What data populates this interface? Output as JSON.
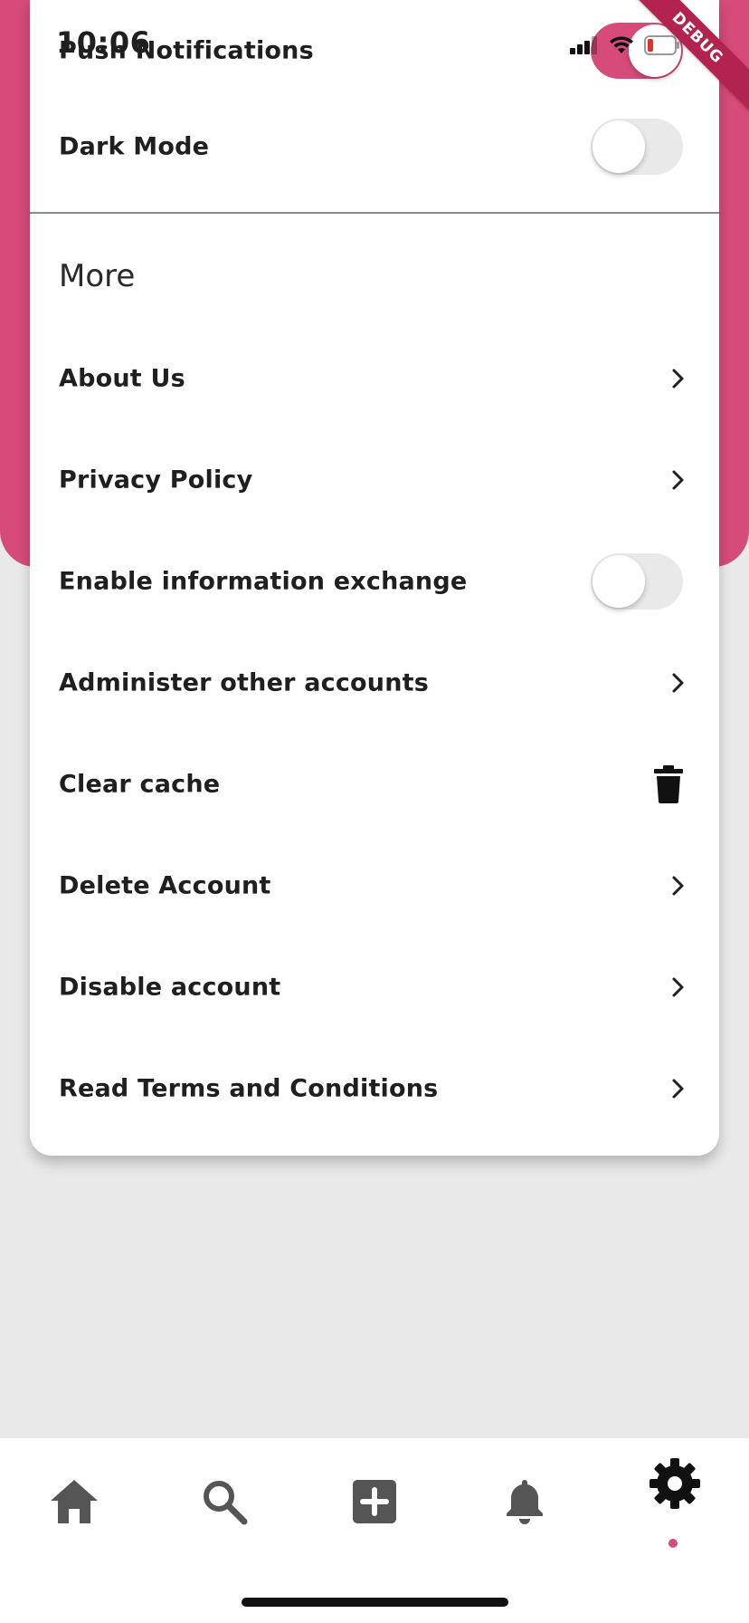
{
  "status_bar": {
    "time": "10:06"
  },
  "debug_banner": "DEBUG",
  "settings": {
    "push_notifications": {
      "label": "Push Notifications",
      "enabled": true
    },
    "dark_mode": {
      "label": "Dark Mode",
      "enabled": false
    }
  },
  "more": {
    "title": "More",
    "items": [
      {
        "label": "About Us",
        "control": "chevron-right-icon"
      },
      {
        "label": "Privacy Policy",
        "control": "chevron-right-icon"
      },
      {
        "label": "Enable information exchange",
        "control": "toggle",
        "enabled": false
      },
      {
        "label": "Administer other accounts",
        "control": "chevron-right-icon"
      },
      {
        "label": "Clear cache",
        "control": "trash-icon"
      },
      {
        "label": "Delete Account",
        "control": "chevron-right-icon"
      },
      {
        "label": "Disable account",
        "control": "chevron-right-icon"
      },
      {
        "label": "Read Terms and Conditions",
        "control": "chevron-right-icon"
      }
    ]
  },
  "bottom_nav": {
    "items": [
      {
        "icon": "home-icon",
        "active": false
      },
      {
        "icon": "search-icon",
        "active": false
      },
      {
        "icon": "add-box-icon",
        "active": false
      },
      {
        "icon": "bell-icon",
        "active": false
      },
      {
        "icon": "settings-gear-icon",
        "active": true
      }
    ]
  },
  "colors": {
    "accent": "#d64b79",
    "background": "#e9e9ea",
    "card": "#ffffff",
    "text": "#1f1f1f",
    "nav_icon": "#555555",
    "nav_icon_active": "#111111"
  }
}
